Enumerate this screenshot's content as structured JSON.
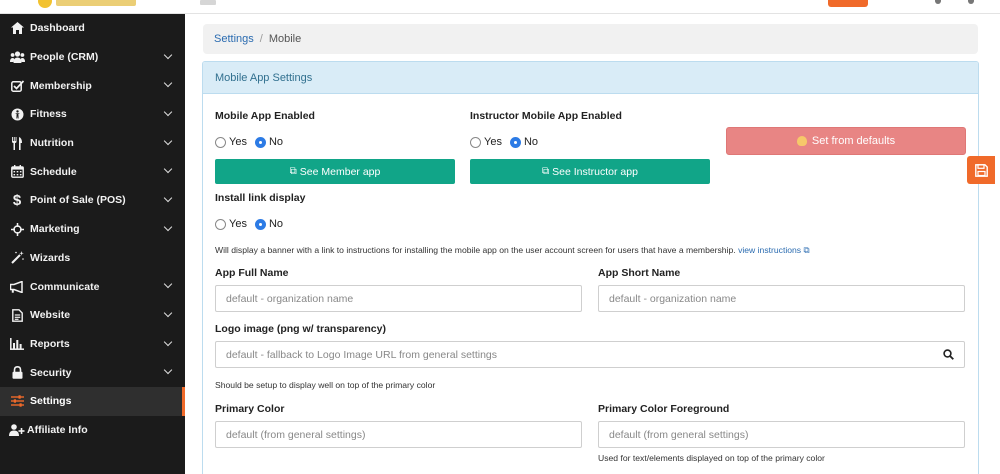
{
  "sidebar": {
    "items": [
      {
        "label": "Dashboard",
        "icon": "home-icon",
        "expandable": false
      },
      {
        "label": "People (CRM)",
        "icon": "people-icon",
        "expandable": true
      },
      {
        "label": "Membership",
        "icon": "checkbox-icon",
        "expandable": true
      },
      {
        "label": "Fitness",
        "icon": "fitness-icon",
        "expandable": true
      },
      {
        "label": "Nutrition",
        "icon": "utensils-icon",
        "expandable": true
      },
      {
        "label": "Schedule",
        "icon": "calendar-icon",
        "expandable": true
      },
      {
        "label": "Point of Sale (POS)",
        "icon": "dollar-icon",
        "expandable": true
      },
      {
        "label": "Marketing",
        "icon": "crosshair-icon",
        "expandable": true
      },
      {
        "label": "Wizards",
        "icon": "wand-icon",
        "expandable": false
      },
      {
        "label": "Communicate",
        "icon": "megaphone-icon",
        "expandable": true
      },
      {
        "label": "Website",
        "icon": "document-icon",
        "expandable": true
      },
      {
        "label": "Reports",
        "icon": "bar-chart-icon",
        "expandable": true
      },
      {
        "label": "Security",
        "icon": "lock-icon",
        "expandable": true
      },
      {
        "label": "Settings",
        "icon": "sliders-icon",
        "expandable": false,
        "active": true
      },
      {
        "label": "Affiliate Info",
        "icon": "user-plus-icon",
        "expandable": false
      }
    ]
  },
  "breadcrumb": {
    "parent": "Settings",
    "separator": "/",
    "current": "Mobile"
  },
  "panel": {
    "title": "Mobile App Settings",
    "mobile_app_enabled": {
      "label": "Mobile App Enabled",
      "yes": "Yes",
      "no": "No",
      "selected": "No"
    },
    "instructor_app_enabled": {
      "label": "Instructor Mobile App Enabled",
      "yes": "Yes",
      "no": "No",
      "selected": "No"
    },
    "set_defaults_label": "Set from defaults",
    "see_member_app_label": "See Member app",
    "see_instructor_app_label": "See Instructor app",
    "install_link": {
      "label": "Install link display",
      "yes": "Yes",
      "no": "No",
      "selected": "No"
    },
    "install_help": "Will display a banner with a link to instructions for installing the mobile app on the user account screen for users that have a membership.",
    "install_help_link": "view instructions",
    "app_full_name": {
      "label": "App Full Name",
      "placeholder": "default - organization name"
    },
    "app_short_name": {
      "label": "App Short Name",
      "placeholder": "default - organization name"
    },
    "logo_image": {
      "label": "Logo image (png w/ transparency)",
      "placeholder": "default - fallback to Logo Image URL from general settings"
    },
    "logo_help": "Should be setup to display well on top of the primary color",
    "primary_color": {
      "label": "Primary Color",
      "placeholder": "default (from general settings)"
    },
    "primary_color_fg": {
      "label": "Primary Color Foreground",
      "placeholder": "default (from general settings)"
    },
    "primary_fg_help": "Used for text/elements displayed on top of the primary color"
  },
  "colors": {
    "accent": "#f06a2a",
    "green": "#11a588",
    "red_button": "#e88584",
    "sidebar": "#1b1b1b",
    "panel_header": "#d9ecf7"
  }
}
